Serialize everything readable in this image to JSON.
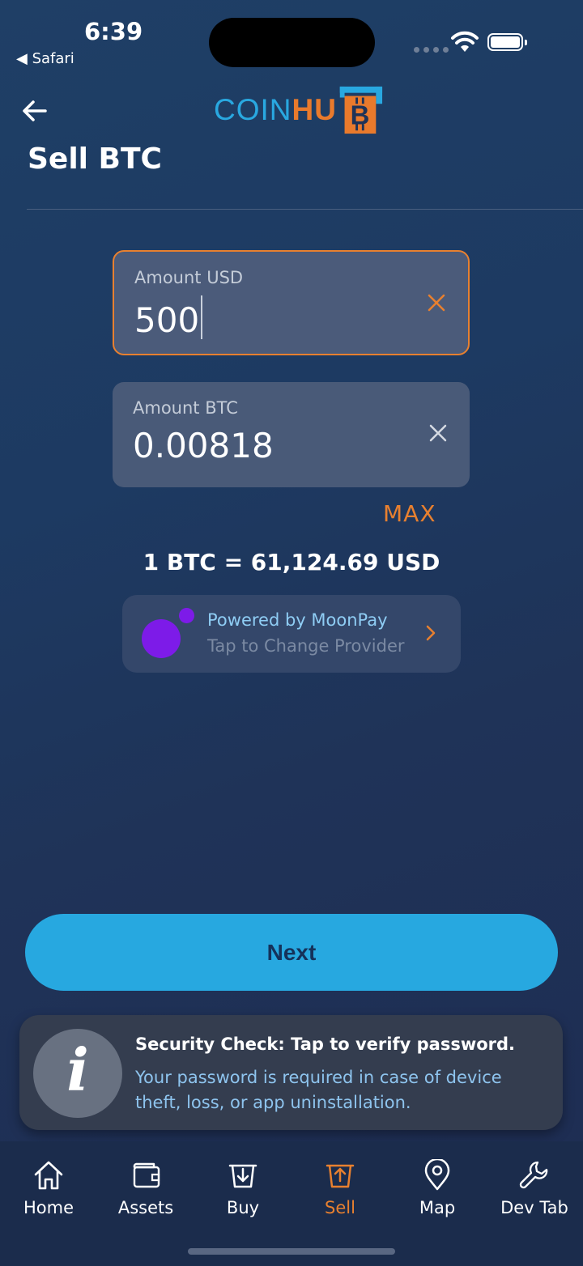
{
  "status_bar": {
    "time": "6:39",
    "back_app": "◀ Safari"
  },
  "header": {
    "logo_coin": "COIN",
    "logo_hub": "HU",
    "title": "Sell BTC"
  },
  "form": {
    "usd": {
      "label": "Amount USD",
      "value": "500"
    },
    "btc": {
      "label": "Amount BTC",
      "value": "0.00818"
    },
    "max_label": "MAX",
    "rate": "1 BTC = 61,124.69 USD"
  },
  "provider": {
    "line1": "Powered by MoonPay",
    "line2": "Tap to Change Provider"
  },
  "next_label": "Next",
  "toast": {
    "title": "Security Check: Tap to verify password.",
    "body": "Your password is required in case of device theft, loss, or app uninstallation."
  },
  "tabs": [
    {
      "label": "Home",
      "icon": "home-icon"
    },
    {
      "label": "Assets",
      "icon": "wallet-icon"
    },
    {
      "label": "Buy",
      "icon": "buy-icon"
    },
    {
      "label": "Sell",
      "icon": "sell-icon",
      "active": true
    },
    {
      "label": "Map",
      "icon": "map-pin-icon"
    },
    {
      "label": "Dev Tab",
      "icon": "wrench-icon"
    }
  ],
  "colors": {
    "accent_orange": "#e8802f",
    "accent_blue": "#27a8e0",
    "moonpay_purple": "#7d1be8"
  }
}
